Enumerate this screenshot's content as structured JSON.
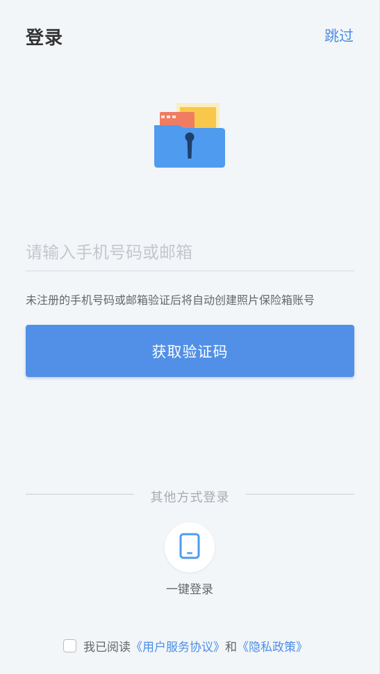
{
  "header": {
    "title": "登录",
    "skip_label": "跳过"
  },
  "illustration": {
    "name": "photo-vault-folder-icon"
  },
  "form": {
    "account_placeholder": "请输入手机号码或邮箱",
    "account_value": "",
    "hint": "未注册的手机号码或邮箱验证后将自动创建照片保险箱账号",
    "submit_label": "获取验证码"
  },
  "other_methods": {
    "label": "其他方式登录",
    "one_click_icon": "phone-icon",
    "one_click_label": "一键登录"
  },
  "agreement": {
    "checked": false,
    "prefix": "我已阅读",
    "service_link": "《用户服务协议》",
    "conjunction": "和",
    "privacy_link": "《隐私政策》"
  },
  "colors": {
    "accent": "#5190e6",
    "link": "#4b8ee6",
    "background": "#f3f6f9"
  }
}
